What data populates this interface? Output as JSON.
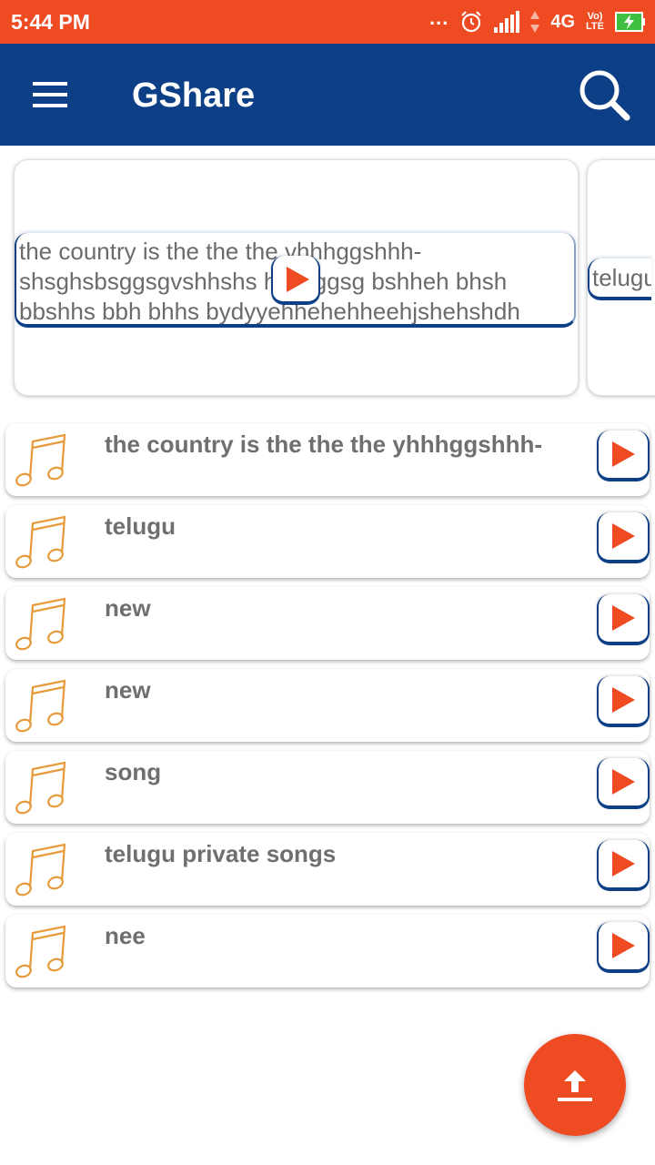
{
  "status_bar": {
    "time": "5:44 PM",
    "dots": "...",
    "network": "4G",
    "volte_top": "Vo)",
    "volte_bottom": "LTE"
  },
  "app_bar": {
    "title": "GShare"
  },
  "carousel": [
    {
      "text": "the country is the the the yhhhggshhh-shsghsbsggsgvshhshs hshsggsg bshheh bhsh bbshhs bbh bhhs bydyyehhehehheehjshehshdh"
    },
    {
      "text": "telugu"
    }
  ],
  "songs": [
    {
      "title": "the country is the the the yhhhggshhh-"
    },
    {
      "title": "telugu"
    },
    {
      "title": "new"
    },
    {
      "title": "new"
    },
    {
      "title": "song"
    },
    {
      "title": "telugu private songs"
    },
    {
      "title": "nee"
    }
  ],
  "colors": {
    "accent": "#ee4b22",
    "primary": "#0d3f86",
    "note": "#e69a3a"
  }
}
